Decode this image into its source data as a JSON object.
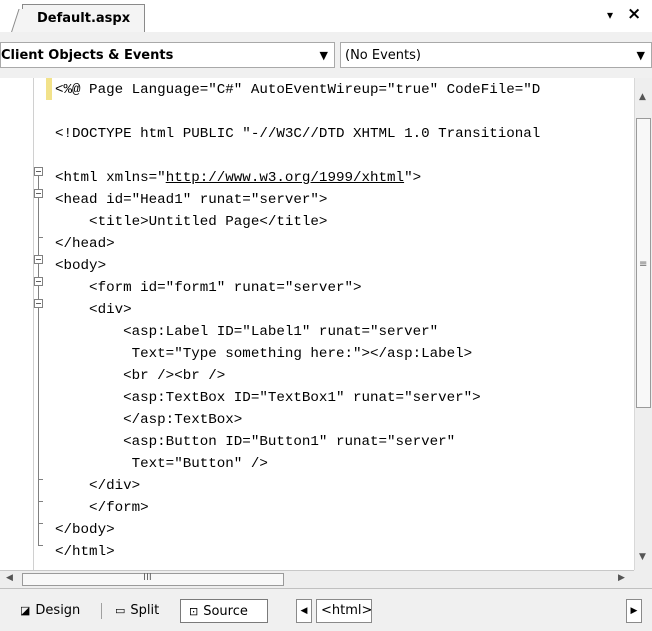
{
  "tab": {
    "title": "Default.aspx",
    "dropdown_glyph": "▾",
    "close_glyph": "×"
  },
  "navigation": {
    "objects_selected": "Client Objects & Events",
    "events_selected": "(No Events)",
    "arrow_glyph": "▼"
  },
  "code_lines": [
    {
      "pre": "<%@ Page Language=\"C#\" AutoEventWireup=\"true\" CodeFile=\"D",
      "link": "",
      "post": ""
    },
    {
      "pre": "",
      "link": "",
      "post": ""
    },
    {
      "pre": "<!DOCTYPE html PUBLIC \"-//W3C//DTD XHTML 1.0 Transitional",
      "link": "",
      "post": ""
    },
    {
      "pre": "",
      "link": "",
      "post": ""
    },
    {
      "pre": "<html xmlns=\"",
      "link": "http://www.w3.org/1999/xhtml",
      "post": "\">"
    },
    {
      "pre": "<head id=\"Head1\" runat=\"server\">",
      "link": "",
      "post": ""
    },
    {
      "pre": "    <title>Untitled Page</title>",
      "link": "",
      "post": ""
    },
    {
      "pre": "</head>",
      "link": "",
      "post": ""
    },
    {
      "pre": "<body>",
      "link": "",
      "post": ""
    },
    {
      "pre": "    <form id=\"form1\" runat=\"server\">",
      "link": "",
      "post": ""
    },
    {
      "pre": "    <div>",
      "link": "",
      "post": ""
    },
    {
      "pre": "        <asp:Label ID=\"Label1\" runat=\"server\"",
      "link": "",
      "post": ""
    },
    {
      "pre": "         Text=\"Type something here:\"></asp:Label>",
      "link": "",
      "post": ""
    },
    {
      "pre": "        <br /><br />",
      "link": "",
      "post": ""
    },
    {
      "pre": "        <asp:TextBox ID=\"TextBox1\" runat=\"server\">",
      "link": "",
      "post": ""
    },
    {
      "pre": "        </asp:TextBox>",
      "link": "",
      "post": ""
    },
    {
      "pre": "        <asp:Button ID=\"Button1\" runat=\"server\"",
      "link": "",
      "post": ""
    },
    {
      "pre": "         Text=\"Button\" />",
      "link": "",
      "post": ""
    },
    {
      "pre": "    </div>",
      "link": "",
      "post": ""
    },
    {
      "pre": "    </form>",
      "link": "",
      "post": ""
    },
    {
      "pre": "</body>",
      "link": "",
      "post": ""
    },
    {
      "pre": "</html>",
      "link": "",
      "post": ""
    }
  ],
  "scrollbar": {
    "vertical_grip": "≡",
    "horizontal_grip": "III"
  },
  "view_bar": {
    "design_label": "Design",
    "split_label": "Split",
    "source_label": "Source",
    "breadcrumb_tag": "<html>",
    "active_view": "Source"
  },
  "colors": {
    "background": "#ffffff",
    "chrome": "#f0f0f0",
    "outline_indicator": "#f2e28a"
  }
}
